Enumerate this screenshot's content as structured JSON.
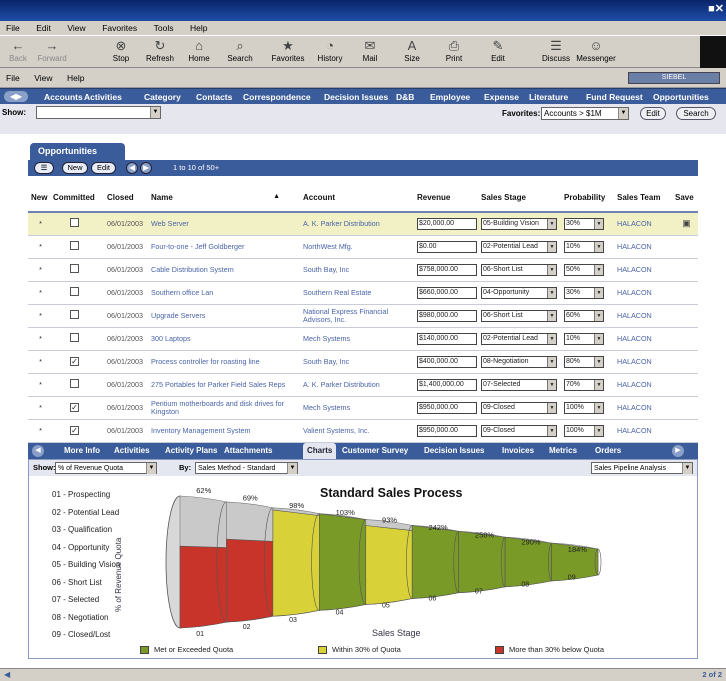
{
  "window": {
    "controls": "■✕"
  },
  "menubar": [
    "File",
    "Edit",
    "View",
    "Favorites",
    "Tools",
    "Help"
  ],
  "toolbar": [
    {
      "label": "Back",
      "icon": "back-arrow-icon",
      "glyph": "←",
      "disabled": true
    },
    {
      "label": "Forward",
      "icon": "forward-arrow-icon",
      "glyph": "→",
      "disabled": true
    },
    {
      "label": "Stop",
      "icon": "stop-icon",
      "glyph": "⊗",
      "disabled": false
    },
    {
      "label": "Refresh",
      "icon": "refresh-icon",
      "glyph": "↻",
      "disabled": false
    },
    {
      "label": "Home",
      "icon": "home-icon",
      "glyph": "⌂",
      "disabled": false
    },
    {
      "label": "Search",
      "icon": "search-icon",
      "glyph": "⌕",
      "disabled": false
    },
    {
      "label": "Favorites",
      "icon": "favorites-icon",
      "glyph": "★",
      "disabled": false
    },
    {
      "label": "History",
      "icon": "history-icon",
      "glyph": "◔",
      "disabled": false
    },
    {
      "label": "Mail",
      "icon": "mail-icon",
      "glyph": "✉",
      "disabled": false
    },
    {
      "label": "Size",
      "icon": "font-size-icon",
      "glyph": "A",
      "disabled": false
    },
    {
      "label": "Print",
      "icon": "print-icon",
      "glyph": "⎙",
      "disabled": false
    },
    {
      "label": "Edit",
      "icon": "edit-icon",
      "glyph": "✎",
      "disabled": false
    },
    {
      "label": "Discuss",
      "icon": "discuss-icon",
      "glyph": "☰",
      "disabled": false
    },
    {
      "label": "Messenger",
      "icon": "messenger-icon",
      "glyph": "☺",
      "disabled": false
    }
  ],
  "appmenu": [
    "File",
    "View",
    "Help"
  ],
  "oracle_logo": "SIEBEL",
  "navtabs": [
    "Accounts",
    "Activities",
    "Category",
    "Contacts",
    "Correspondence",
    "Decision Issues",
    "D&B",
    "Employee",
    "Expense",
    "Literature",
    "Fund Request",
    "Opportunities"
  ],
  "show": {
    "label": "Show:",
    "value": ""
  },
  "favorites": {
    "label": "Favorites:",
    "value": "Accounts > $1M",
    "edit": "Edit",
    "search": "Search"
  },
  "opportunities": {
    "tab": "Opportunities",
    "menu": "☰",
    "new": "New",
    "edit": "Edit",
    "count": "1 to 10 of 50+",
    "columns": [
      "New",
      "Committed",
      "Closed",
      "Name",
      "Account",
      "Revenue",
      "Sales Stage",
      "Probability",
      "Sales Team",
      "Save"
    ],
    "rows": [
      {
        "new": "*",
        "committed": false,
        "closed": "06/01/2003",
        "name": "Web Server",
        "account": "A. K. Parker Distribution",
        "revenue": "$20,000.00",
        "stage": "05-Building Vision",
        "prob": "30%",
        "team": "HALACON",
        "highlight": true,
        "save": true
      },
      {
        "new": "*",
        "committed": false,
        "closed": "06/01/2003",
        "name": "Four-to-one - Jeff Goldberger",
        "account": "NorthWest Mfg.",
        "revenue": "$0.00",
        "stage": "02-Potential Lead",
        "prob": "10%",
        "team": "HALACON",
        "highlight": false,
        "save": false
      },
      {
        "new": "*",
        "committed": false,
        "closed": "06/01/2003",
        "name": "Cable Distribution System",
        "account": "South Bay, Inc",
        "revenue": "$758,000.00",
        "stage": "06-Short List",
        "prob": "50%",
        "team": "HALACON",
        "highlight": false,
        "save": false
      },
      {
        "new": "*",
        "committed": false,
        "closed": "06/01/2003",
        "name": "Southern office Lan",
        "account": "Southern Real Estate",
        "revenue": "$660,000.00",
        "stage": "04-Opportunity",
        "prob": "30%",
        "team": "HALACON",
        "highlight": false,
        "save": false
      },
      {
        "new": "*",
        "committed": false,
        "closed": "06/01/2003",
        "name": "Upgrade Servers",
        "account": "National Express Financial Advisors, Inc.",
        "revenue": "$980,000.00",
        "stage": "06-Short List",
        "prob": "60%",
        "team": "HALACON",
        "highlight": false,
        "save": false
      },
      {
        "new": "*",
        "committed": false,
        "closed": "06/01/2003",
        "name": "300 Laptops",
        "account": "Mech Systems",
        "revenue": "$140,000.00",
        "stage": "02-Potential Lead",
        "prob": "10%",
        "team": "HALACON",
        "highlight": false,
        "save": false
      },
      {
        "new": "*",
        "committed": true,
        "closed": "06/01/2003",
        "name": "Process controller for roasting line",
        "account": "South Bay, Inc",
        "revenue": "$400,000.00",
        "stage": "08-Negotiation",
        "prob": "80%",
        "team": "HALACON",
        "highlight": false,
        "save": false
      },
      {
        "new": "*",
        "committed": false,
        "closed": "06/01/2003",
        "name": "275 Portables for Parker Field Sales Reps",
        "account": "A. K. Parker Distribution",
        "revenue": "$1,400,000.00",
        "stage": "07-Selected",
        "prob": "70%",
        "team": "HALACON",
        "highlight": false,
        "save": false
      },
      {
        "new": "*",
        "committed": true,
        "closed": "06/01/2003",
        "name": "Pentium motherboards and disk drives for Kingston",
        "account": "Mech Systems",
        "revenue": "$950,000.00",
        "stage": "09-Closed",
        "prob": "100%",
        "team": "HALACON",
        "highlight": false,
        "save": false
      },
      {
        "new": "*",
        "committed": true,
        "closed": "06/01/2003",
        "name": "Inventory Management System",
        "account": "Valient Systems, Inc.",
        "revenue": "$950,000.00",
        "stage": "09-Closed",
        "prob": "100%",
        "team": "HALACON",
        "highlight": false,
        "save": false
      }
    ]
  },
  "lowtabs": [
    "More Info",
    "Activities",
    "Activity Plans",
    "Attachments",
    "Charts",
    "Customer Survey",
    "Decision Issues",
    "Invoices",
    "Metrics",
    "Orders"
  ],
  "lowtabs_active": "Charts",
  "chart_controls": {
    "show_label": "Show:",
    "show_value": "% of Revenue Quota",
    "by_label": "By:",
    "by_value": "Sales Method - Standard",
    "analysis": "Sales Pipeline Analysis"
  },
  "chart_data": {
    "type": "funnel",
    "title": "Standard Sales Process",
    "xlabel": "Sales Stage",
    "ylabel": "% of Revenue Quota",
    "stages": [
      "01 - Prospecting",
      "02 - Potential Lead",
      "03 - Qualification",
      "04 - Opportunity",
      "05 - Building Vision",
      "06 - Short List",
      "07 - Selected",
      "08 - Negotiation",
      "09 - Closed/Lost"
    ],
    "categories": [
      "01",
      "02",
      "03",
      "04",
      "05",
      "06",
      "07",
      "08",
      "09"
    ],
    "values": [
      62,
      69,
      98,
      103,
      93,
      242,
      258,
      290,
      184
    ],
    "value_labels": [
      "62%",
      "69%",
      "98%",
      "103%",
      "93%",
      "242%",
      "258%",
      "290%",
      "184%"
    ],
    "status": [
      "below",
      "below",
      "within",
      "met",
      "within",
      "met",
      "met",
      "met",
      "met"
    ],
    "legend": [
      {
        "label": "Met or Exceeded Quota",
        "color": "#7a9a28"
      },
      {
        "label": "Within 30% of Quota",
        "color": "#d8d238"
      },
      {
        "label": "More than 30% below Quota",
        "color": "#c8342a"
      }
    ]
  },
  "statusbar": {
    "page": "2 of 2"
  }
}
